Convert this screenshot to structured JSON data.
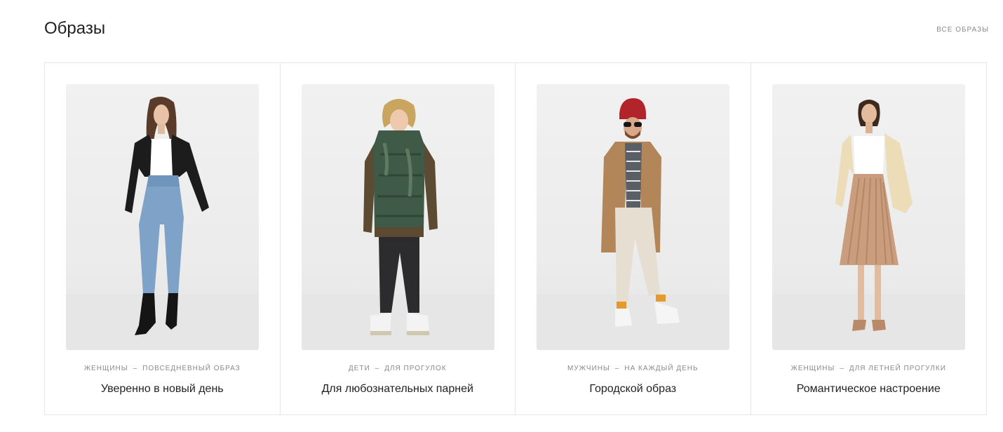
{
  "section": {
    "title": "Образы",
    "all_link": "ВСЕ ОБРАЗЫ"
  },
  "separator": "–",
  "looks": [
    {
      "audience": "ЖЕНЩИНЫ",
      "occasion": "ПОВСЕДНЕВНЫЙ ОБРАЗ",
      "title": "Уверенно в новый день",
      "image": "woman-leather-jacket-jeans-photo"
    },
    {
      "audience": "ДЕТИ",
      "occasion": "ДЛЯ ПРОГУЛОК",
      "title": "Для любознательных парней",
      "image": "boy-camo-vest-photo"
    },
    {
      "audience": "МУЖЧИНЫ",
      "occasion": "НА КАЖДЫЙ ДЕНЬ",
      "title": "Городской образ",
      "image": "man-camel-coat-red-beanie-photo"
    },
    {
      "audience": "ЖЕНЩИНЫ",
      "occasion": "ДЛЯ ЛЕТНЕЙ ПРОГУЛКИ",
      "title": "Романтическое настроение",
      "image": "woman-pleated-skirt-beige-blazer-photo"
    }
  ]
}
